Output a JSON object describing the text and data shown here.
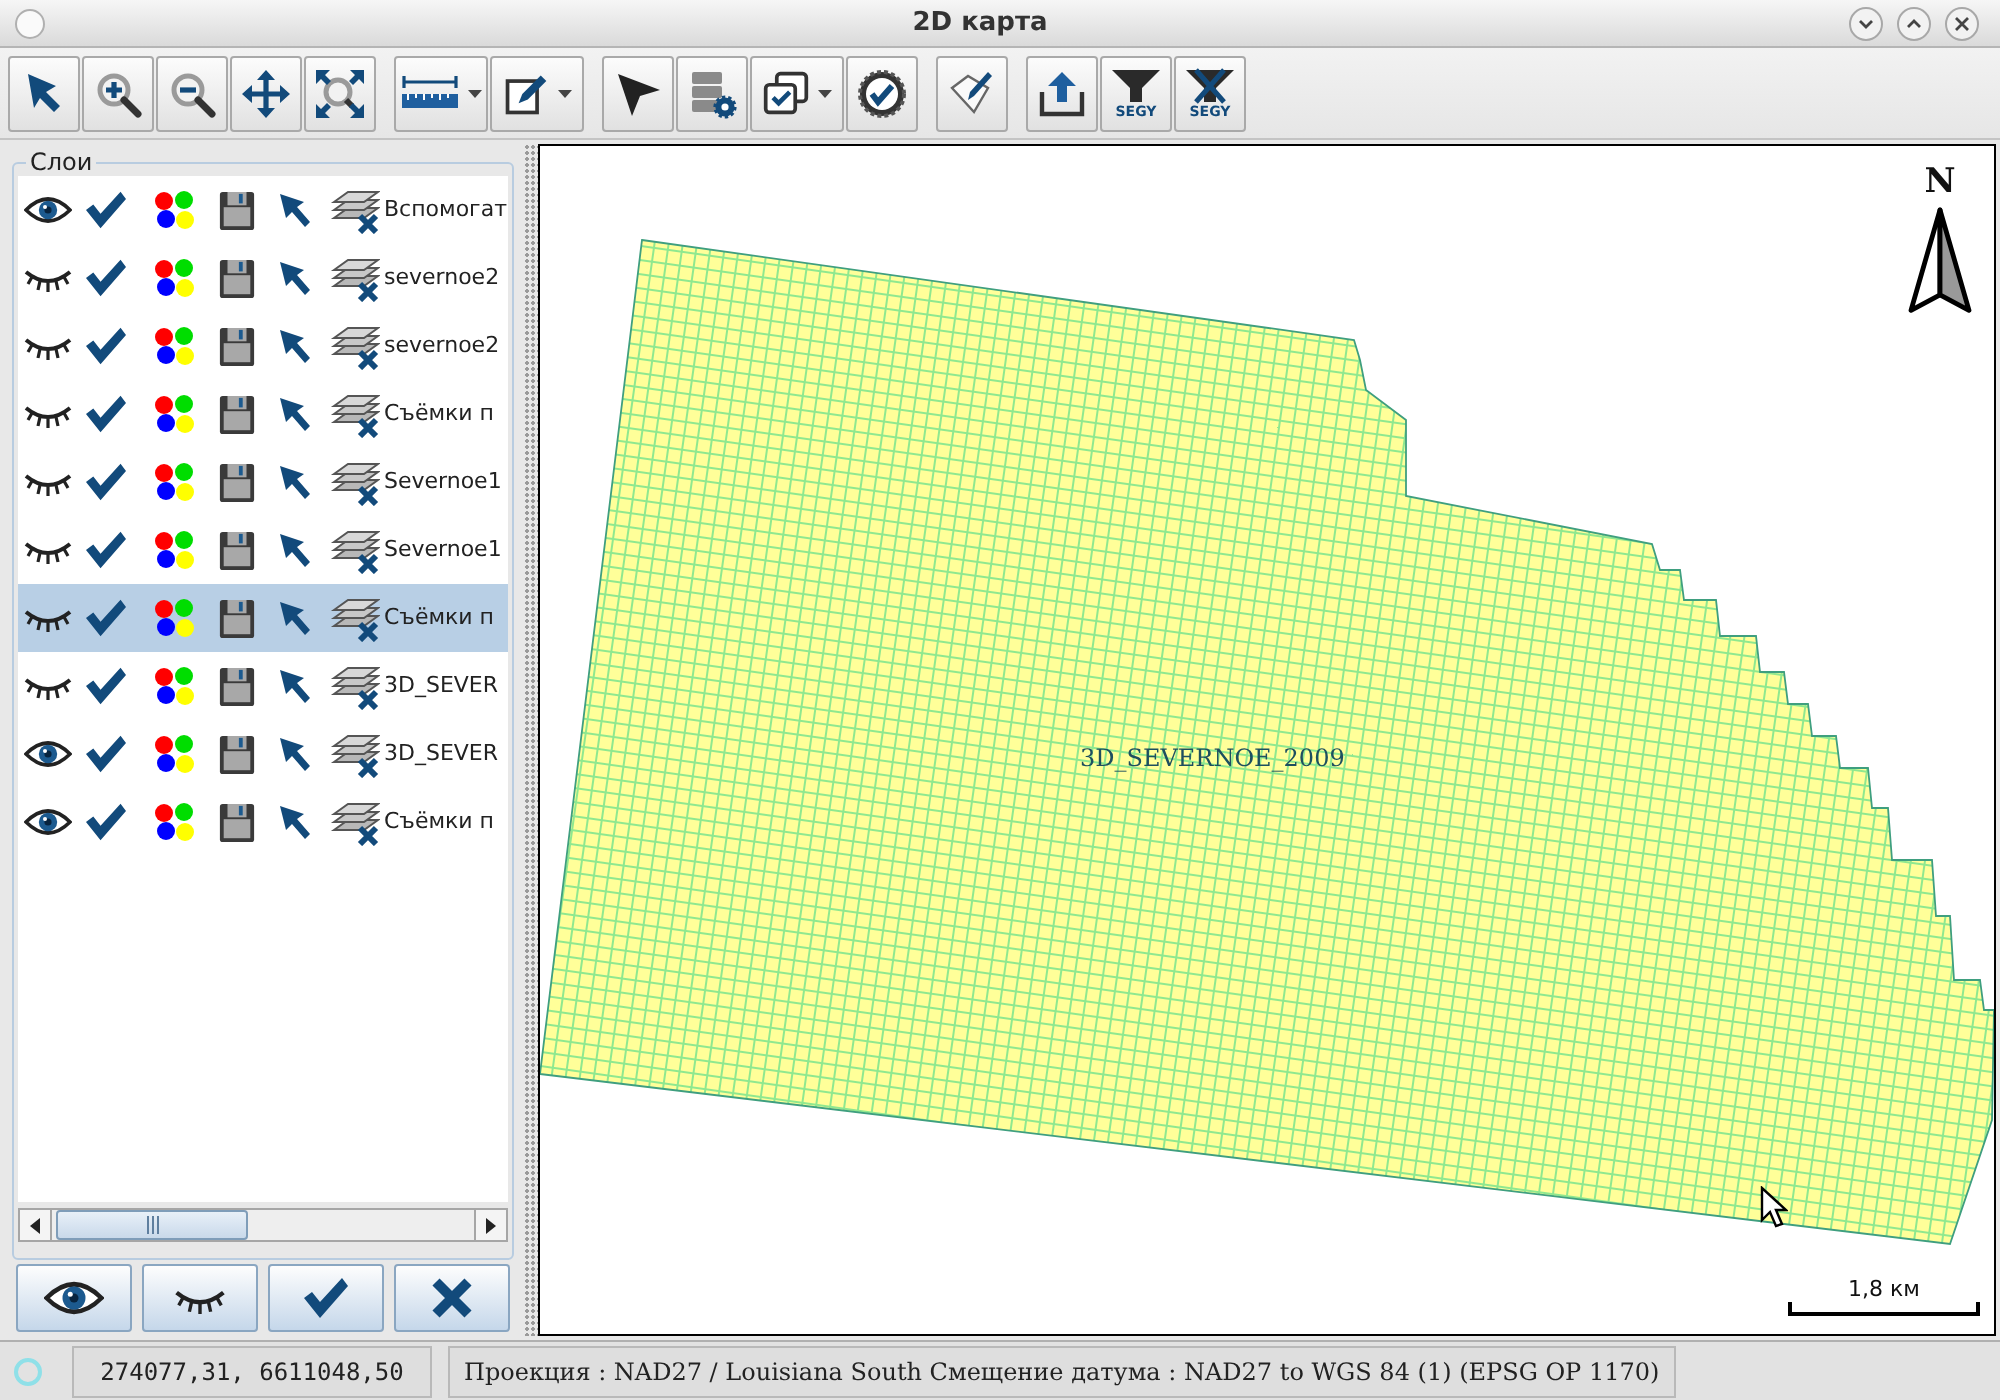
{
  "window": {
    "title": "2D карта"
  },
  "toolbar": {
    "groups": [
      {
        "buttons": [
          {
            "has_menu": false
          },
          {
            "has_menu": false
          },
          {
            "has_menu": false
          },
          {
            "has_menu": false
          },
          {
            "has_menu": false
          }
        ]
      },
      {
        "buttons": [
          {
            "has_menu": true
          },
          {
            "has_menu": true
          }
        ]
      },
      {
        "buttons": [
          {
            "has_menu": false
          },
          {
            "has_menu": false
          },
          {
            "has_menu": true
          },
          {
            "has_menu": false
          }
        ]
      },
      {
        "buttons": [
          {
            "has_menu": false
          }
        ]
      },
      {
        "buttons": [
          {
            "has_menu": false
          },
          {
            "has_menu": false,
            "caption": "SEGY"
          },
          {
            "has_menu": false,
            "caption": "SEGY"
          }
        ]
      }
    ]
  },
  "layers_panel": {
    "title": "Слои",
    "layers": [
      {
        "name": "Вспомогат",
        "visible": true,
        "checked": true,
        "selected": false
      },
      {
        "name": "severnoe2",
        "visible": false,
        "checked": true,
        "selected": false
      },
      {
        "name": "severnoe2",
        "visible": false,
        "checked": true,
        "selected": false
      },
      {
        "name": "Съёмки п",
        "visible": false,
        "checked": true,
        "selected": false
      },
      {
        "name": "Severnoe1",
        "visible": false,
        "checked": true,
        "selected": false
      },
      {
        "name": "Severnoe1",
        "visible": false,
        "checked": true,
        "selected": false
      },
      {
        "name": "Съёмки п",
        "visible": false,
        "checked": true,
        "selected": true
      },
      {
        "name": "3D_SEVER",
        "visible": false,
        "checked": true,
        "selected": false
      },
      {
        "name": "3D_SEVER",
        "visible": true,
        "checked": true,
        "selected": false
      },
      {
        "name": "Съёмки п",
        "visible": true,
        "checked": true,
        "selected": false
      }
    ]
  },
  "map": {
    "label": "3D_SEVERNOE_2009",
    "north_label": "N",
    "scale_label": "1,8 км"
  },
  "status_bar": {
    "coordinates": "274077,31, 6611048,50",
    "projection": "Проекция : NAD27 / Louisiana South Смещение датума : NAD27 to WGS 84 (1) (EPSG OP 1170)"
  }
}
